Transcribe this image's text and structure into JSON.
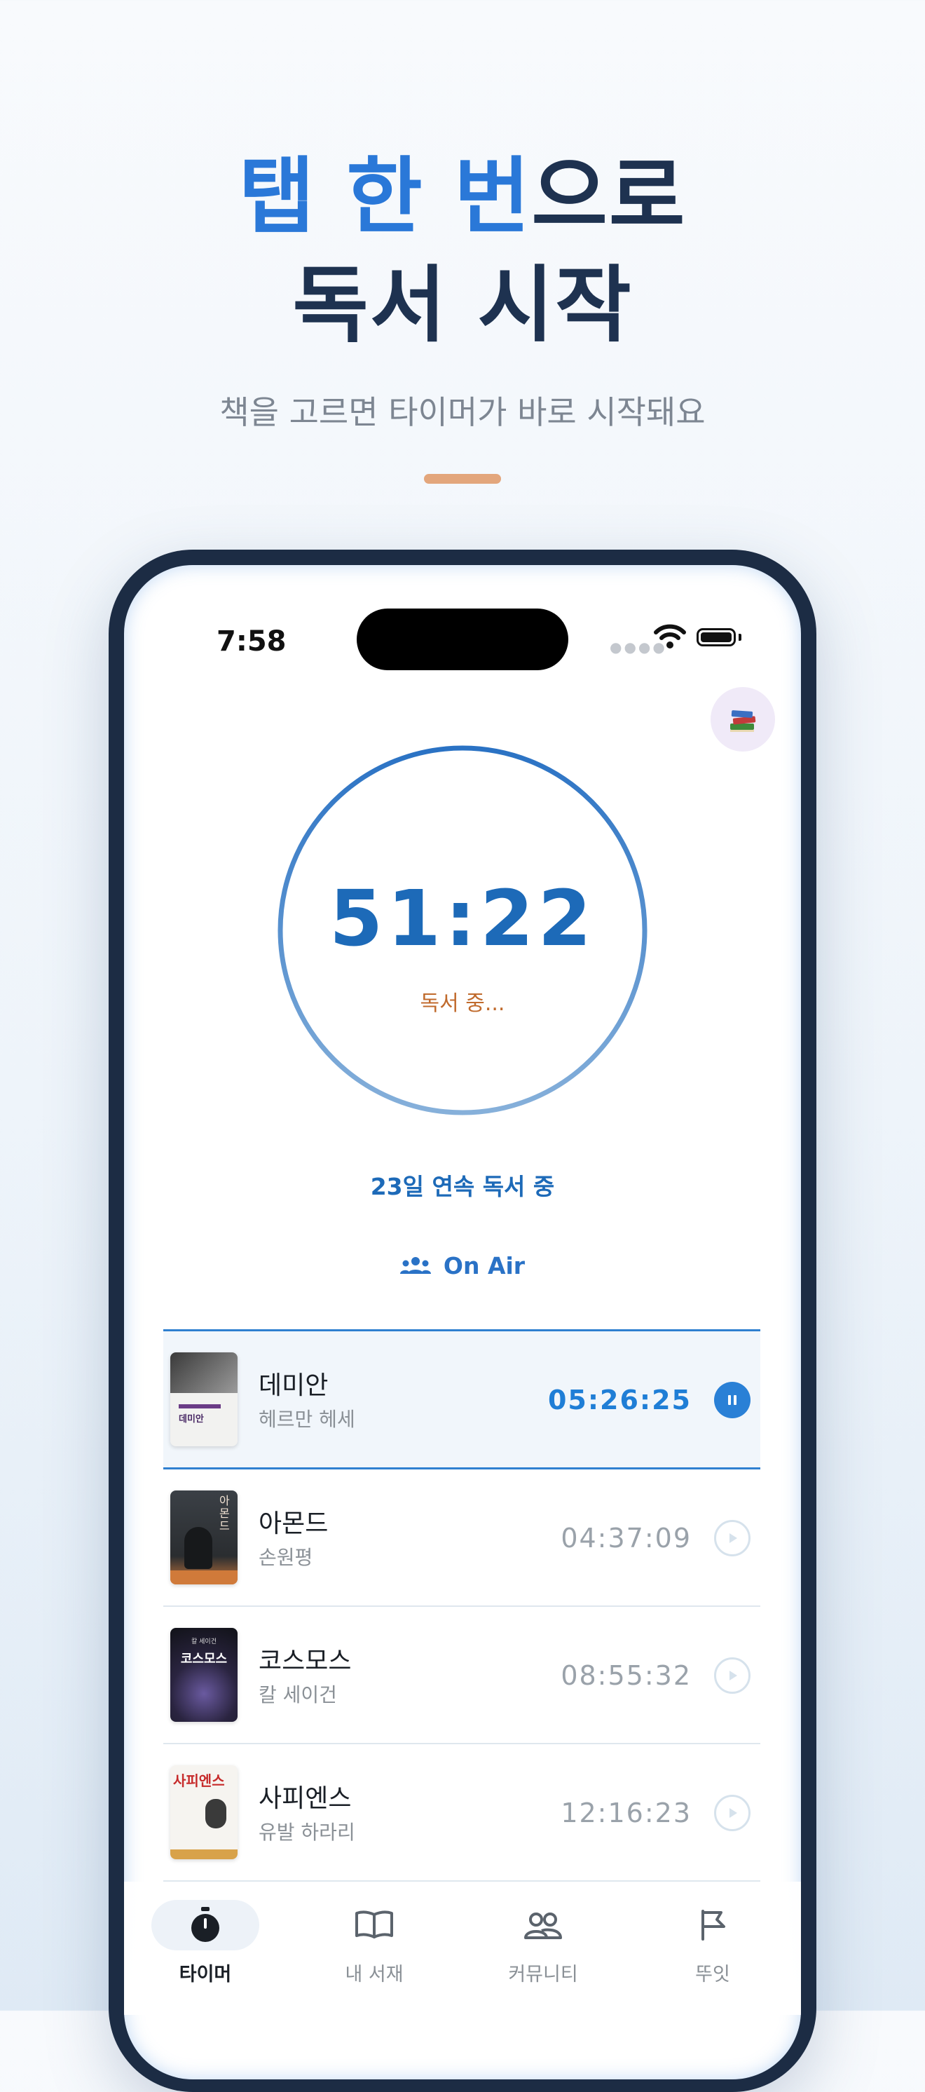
{
  "promo": {
    "headline_line1_accent": "탭 한 번",
    "headline_line1_rest": "으로",
    "headline_line2": "독서 시작",
    "subtitle": "책을 고르면 타이머가 바로 시작돼요"
  },
  "status_bar": {
    "time": "7:58"
  },
  "timer": {
    "value": "51:22",
    "status": "독서 중..."
  },
  "streak_text": "23일 연속 독서 중",
  "on_air_label": "On Air",
  "books": [
    {
      "title": "데미안",
      "author": "헤르만 헤세",
      "time": "05:26:25",
      "active": true
    },
    {
      "title": "아몬드",
      "author": "손원평",
      "time": "04:37:09",
      "active": false
    },
    {
      "title": "코스모스",
      "author": "칼 세이건",
      "time": "08:55:32",
      "active": false
    },
    {
      "title": "사피엔스",
      "author": "유발 하라리",
      "time": "12:16:23",
      "active": false
    }
  ],
  "covers": {
    "demian_text": "데미안",
    "almond_text": "아몬드",
    "cosmos_author": "칼 세이건",
    "cosmos_text": "코스모스",
    "sapiens_text": "사피엔스"
  },
  "tabs": [
    {
      "label": "타이머",
      "icon": "stopwatch-icon",
      "active": true
    },
    {
      "label": "내 서재",
      "icon": "open-book-icon",
      "active": false
    },
    {
      "label": "커뮤니티",
      "icon": "people-icon",
      "active": false
    },
    {
      "label": "뚜잇",
      "icon": "flag-icon",
      "active": false
    }
  ],
  "colors": {
    "accent": "#2a78d8",
    "timer": "#1d6ab8",
    "reading_status": "#c06a2c",
    "divider": "#e3a67c",
    "phone_frame": "#1c2c44"
  }
}
